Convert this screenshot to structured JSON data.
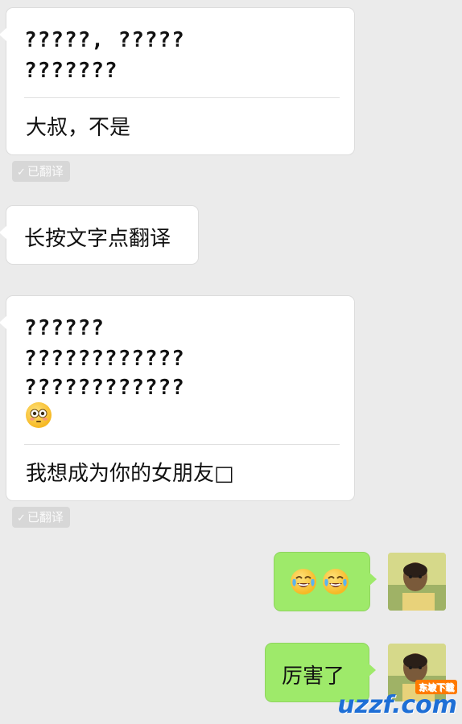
{
  "messages": [
    {
      "id": "msg1",
      "original_lines": [
        "?????, ?????",
        "???????"
      ],
      "translation": "大叔，不是",
      "badge": "已翻译"
    },
    {
      "id": "msg2",
      "text": "长按文字点翻译"
    },
    {
      "id": "msg3",
      "original_lines": [
        "??????",
        "????????????",
        "????????????"
      ],
      "emoji": "flushed-face",
      "translation": "我想成为你的女朋友□",
      "badge": "已翻译"
    },
    {
      "id": "msg4",
      "emoji": [
        "tears-of-joy-face",
        "tears-of-joy-face"
      ]
    },
    {
      "id": "msg5",
      "text": "厉害了"
    }
  ],
  "watermark": {
    "text": "uzzf.com",
    "sub": "东坡下载"
  },
  "colors": {
    "background": "#ebebeb",
    "incoming_bubble": "#ffffff",
    "outgoing_bubble": "#9eea6a",
    "badge": "#d7d7d7",
    "watermark": "#1e6fd6"
  }
}
